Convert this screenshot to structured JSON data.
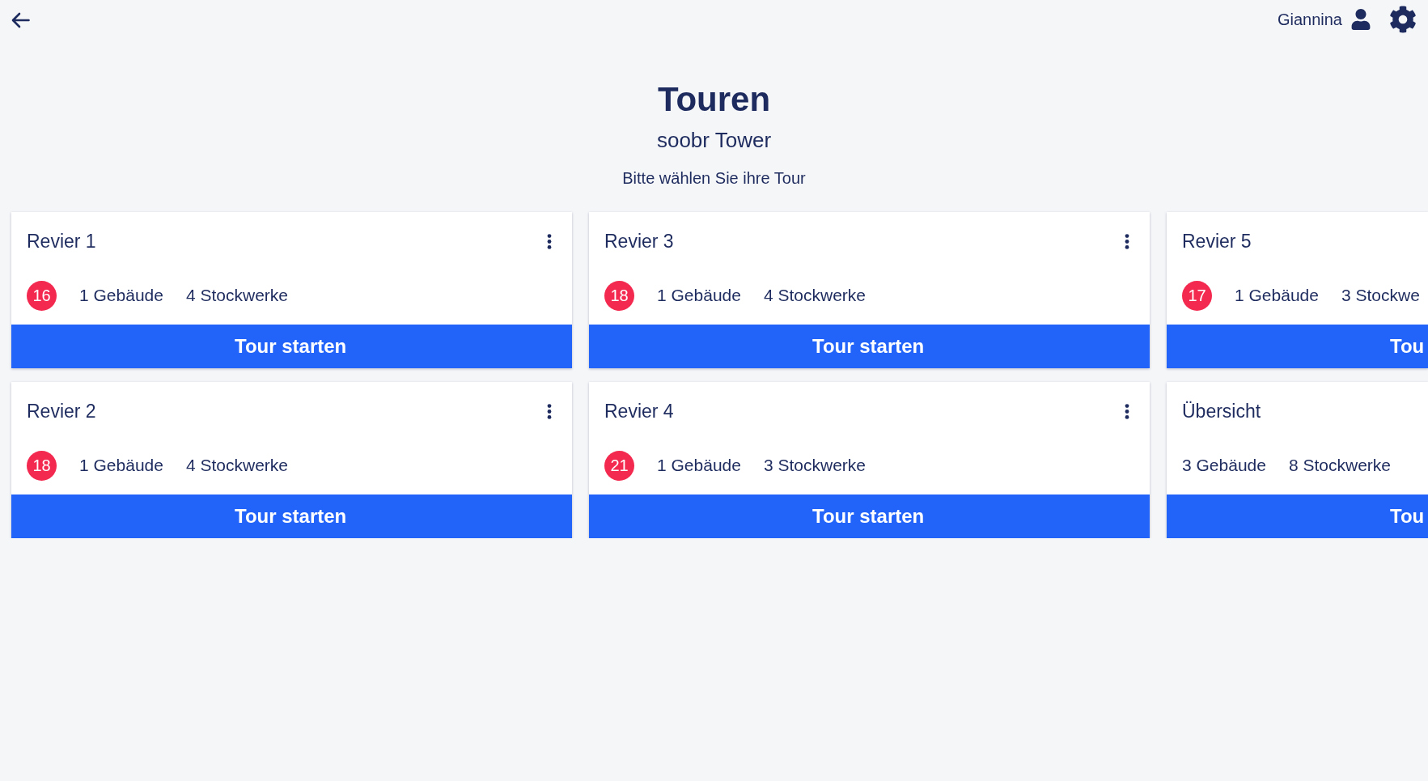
{
  "header": {
    "user_name": "Giannina"
  },
  "page": {
    "title": "Touren",
    "subtitle": "soobr Tower",
    "prompt": "Bitte wählen Sie ihre Tour"
  },
  "tours": [
    {
      "title": "Revier 1",
      "count": "16",
      "buildings": "1 Gebäude",
      "floors": "4 Stockwerke",
      "button": "Tour starten",
      "menu_button": true
    },
    {
      "title": "Revier 2",
      "count": "18",
      "buildings": "1 Gebäude",
      "floors": "4 Stockwerke",
      "button": "Tour starten",
      "menu_button": true
    },
    {
      "title": "Revier 3",
      "count": "18",
      "buildings": "1 Gebäude",
      "floors": "4 Stockwerke",
      "button": "Tour starten",
      "menu_button": true
    },
    {
      "title": "Revier 4",
      "count": "21",
      "buildings": "1 Gebäude",
      "floors": "3 Stockwerke",
      "button": "Tour starten",
      "menu_button": true
    },
    {
      "title": "Revier 5",
      "count": "17",
      "buildings": "1 Gebäude",
      "floors": "3 Stockwe",
      "button": "Tou",
      "menu_button": false
    },
    {
      "title": "Übersicht",
      "buildings": "3 Gebäude",
      "floors": "8 Stockwerke",
      "button": "Tou",
      "menu_button": false
    }
  ]
}
